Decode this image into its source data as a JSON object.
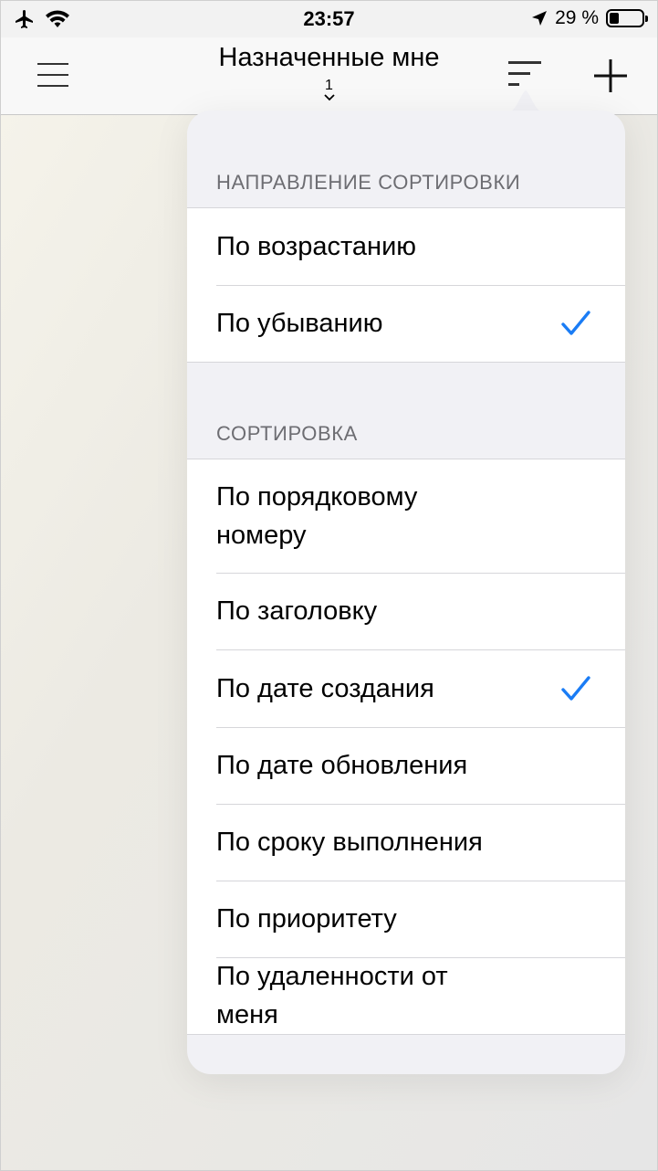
{
  "status_bar": {
    "time": "23:57",
    "battery_percent": "29 %",
    "battery_level": 0.29
  },
  "nav": {
    "title": "Назначенные мне",
    "count": "1",
    "icons": [
      "menu-icon",
      "sort-icon",
      "plus-icon"
    ]
  },
  "sort_direction": {
    "header": "НАПРАВЛЕНИЕ СОРТИРОВКИ",
    "options": [
      {
        "label": "По возрастанию",
        "selected": false
      },
      {
        "label": "По убыванию",
        "selected": true
      }
    ]
  },
  "sort_by": {
    "header": "СОРТИРОВКА",
    "options": [
      {
        "label": "По порядковому номеру",
        "selected": false
      },
      {
        "label": "По заголовку",
        "selected": false
      },
      {
        "label": "По дате создания",
        "selected": true
      },
      {
        "label": "По дате обновления",
        "selected": false
      },
      {
        "label": "По сроку выполнения",
        "selected": false
      },
      {
        "label": "По приоритету",
        "selected": false
      },
      {
        "label": "По удаленности от меня",
        "selected": false
      }
    ]
  },
  "colors": {
    "accent": "#1a7cf5",
    "section_text": "#6d6d72",
    "separator": "#d6d6da"
  }
}
